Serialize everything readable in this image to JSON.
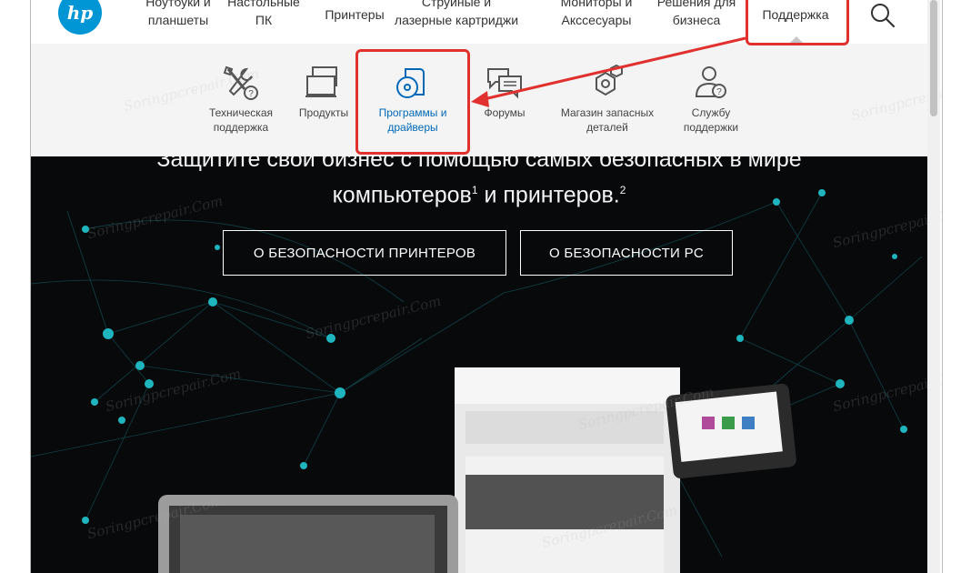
{
  "nav": {
    "logo": "hp",
    "items": [
      {
        "label": "Ноутбуки и\nпланшеты"
      },
      {
        "label": "Настольные\nПК"
      },
      {
        "label": "Принтеры"
      },
      {
        "label": "Струйные и\nлазерные картриджи"
      },
      {
        "label": "Мониторы и\nАкссесуары"
      },
      {
        "label": "Решения для\nбизнеса"
      },
      {
        "label": "Поддержка"
      }
    ],
    "search_icon": "search-icon"
  },
  "submenu": {
    "items": [
      {
        "label": "Техническая\nподдержка",
        "icon": "tools-help-icon"
      },
      {
        "label": "Продукты",
        "icon": "devices-icon"
      },
      {
        "label": "Программы и\nдрайверы",
        "icon": "software-disc-icon"
      },
      {
        "label": "Форумы",
        "icon": "forum-icon"
      },
      {
        "label": "Магазин запасных\nдеталей",
        "icon": "parts-icon"
      },
      {
        "label": "Службу\nподдержки",
        "icon": "support-person-icon"
      }
    ]
  },
  "hero": {
    "title_line1": "Защитите свой бизнес с помощью самых безопасных в мире",
    "title_line2": "компьютеров",
    "sup1": "1",
    "title_line2b": " и принтеров.",
    "sup2": "2",
    "button1": "О БЕЗОПАСНОСТИ ПРИНТЕРОВ",
    "button2": "О БЕЗОПАСНОСТИ PC"
  },
  "colors": {
    "brand": "#0096d6",
    "active": "#0068b7",
    "highlight": "#e0312f",
    "hero_bg": "#07090b",
    "node": "#1fb5bf"
  },
  "watermark": "Soringpcrepair.Com"
}
